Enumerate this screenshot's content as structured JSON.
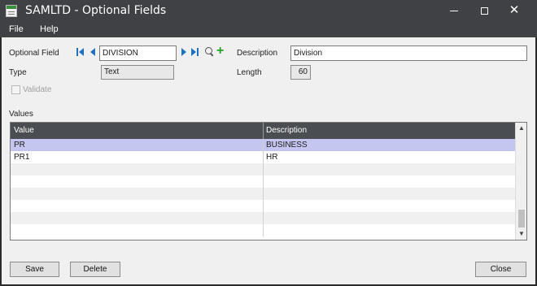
{
  "window": {
    "title": "SAMLTD - Optional Fields",
    "minimize_glyph": "—",
    "close_glyph": "✕"
  },
  "menu": {
    "items": [
      {
        "label": "File"
      },
      {
        "label": "Help"
      }
    ]
  },
  "form": {
    "optional_field_label": "Optional Field",
    "optional_field_value": "DIVISION",
    "description_label": "Description",
    "description_value": "Division",
    "type_label": "Type",
    "type_value": "Text",
    "length_label": "Length",
    "length_value": "60",
    "validate_label": "Validate",
    "validate_checked": false,
    "values_label": "Values"
  },
  "grid": {
    "columns": [
      "Value",
      "Description"
    ],
    "rows": [
      {
        "value": "PR",
        "description": "BUSINESS",
        "selected": true
      },
      {
        "value": "PR1",
        "description": "HR",
        "selected": false
      },
      {
        "value": "",
        "description": "",
        "selected": false
      },
      {
        "value": "",
        "description": "",
        "selected": false
      },
      {
        "value": "",
        "description": "",
        "selected": false
      },
      {
        "value": "",
        "description": "",
        "selected": false
      },
      {
        "value": "",
        "description": "",
        "selected": false
      },
      {
        "value": "",
        "description": "",
        "selected": false
      }
    ]
  },
  "buttons": {
    "save": "Save",
    "delete": "Delete",
    "close": "Close"
  },
  "colors": {
    "titlebar": "#3f4144",
    "grid_header": "#4a4d52",
    "selected_row": "#c4c6ef",
    "nav_arrow": "#1e73be",
    "add_icon": "#23a023"
  },
  "icons": {
    "app": "app-icon",
    "first": "first-record-icon",
    "previous": "previous-record-icon",
    "next": "next-record-icon",
    "last": "last-record-icon",
    "finder": "zoom-icon",
    "new": "plus-icon"
  }
}
